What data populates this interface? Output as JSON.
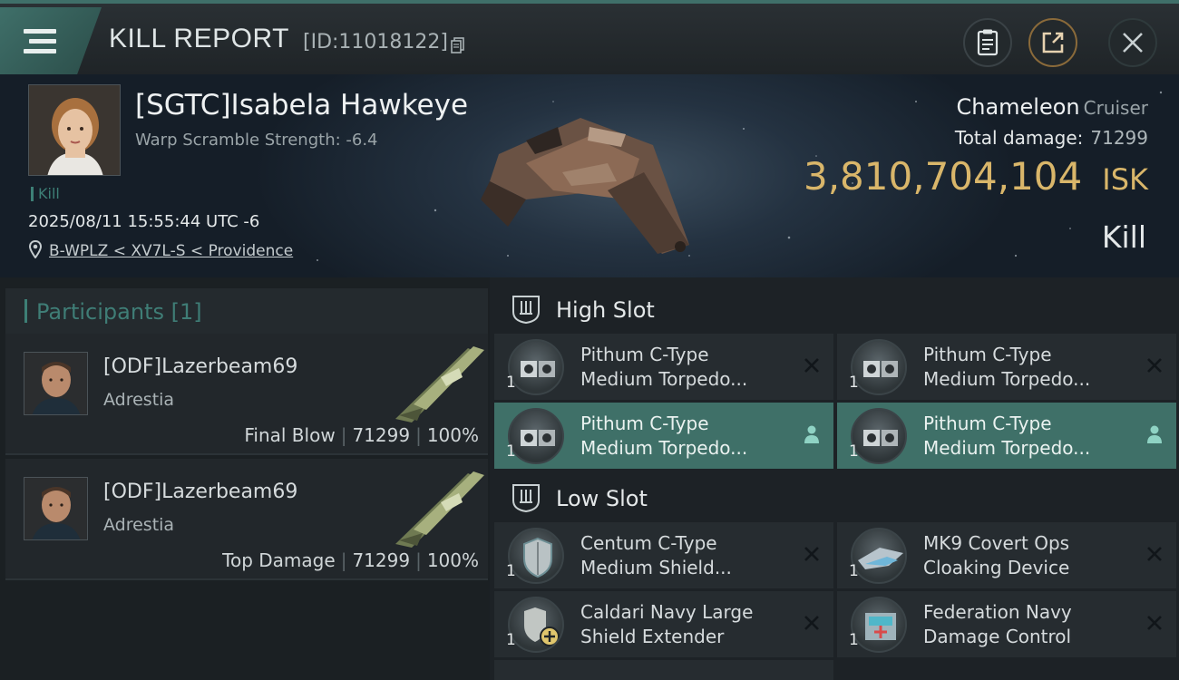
{
  "header": {
    "title": "KILL REPORT",
    "id_text": "[ID:11018122]"
  },
  "victim": {
    "name": "[SGTC]Isabela Hawkeye",
    "warp": "Warp Scramble Strength: -6.4",
    "kill_tag": "Kill",
    "datetime": "2025/08/11 15:55:44 UTC -6",
    "location": "B-WPLZ < XV7L-S < Providence",
    "ship_name": "Chameleon",
    "ship_class": "Cruiser",
    "damage_label": "Total damage:",
    "damage_value": "71299",
    "isk_value": "3,810,704,104",
    "isk_unit": "ISK",
    "result": "Kill"
  },
  "participants": {
    "title": "Participants [1]",
    "rows": [
      {
        "name": "[ODF]Lazerbeam69",
        "ship": "Adrestia",
        "role": "Final Blow",
        "damage": "71299",
        "percent": "100%"
      },
      {
        "name": "[ODF]Lazerbeam69",
        "ship": "Adrestia",
        "role": "Top Damage",
        "damage": "71299",
        "percent": "100%"
      }
    ]
  },
  "slots": {
    "high": {
      "title": "High Slot",
      "modules": [
        {
          "line1": "Pithum C-Type",
          "line2": "Medium Torpedo...",
          "qty": "1",
          "state": "destroyed"
        },
        {
          "line1": "Pithum C-Type",
          "line2": "Medium Torpedo...",
          "qty": "1",
          "state": "destroyed"
        },
        {
          "line1": "Pithum C-Type",
          "line2": "Medium Torpedo...",
          "qty": "1",
          "state": "dropped"
        },
        {
          "line1": "Pithum C-Type",
          "line2": "Medium Torpedo...",
          "qty": "1",
          "state": "dropped"
        }
      ]
    },
    "low": {
      "title": "Low Slot",
      "modules": [
        {
          "line1": "Centum C-Type",
          "line2": "Medium Shield...",
          "qty": "1",
          "state": "destroyed"
        },
        {
          "line1": "MK9 Covert Ops",
          "line2": "Cloaking Device",
          "qty": "1",
          "state": "destroyed"
        },
        {
          "line1": "Caldari Navy Large",
          "line2": "Shield Extender",
          "qty": "1",
          "state": "destroyed"
        },
        {
          "line1": "Federation Navy",
          "line2": "Damage Control",
          "qty": "1",
          "state": "destroyed"
        }
      ]
    }
  },
  "colors": {
    "accent": "#3f7068",
    "isk": "#d9b66a",
    "menu_tab": "#3f6f69"
  }
}
